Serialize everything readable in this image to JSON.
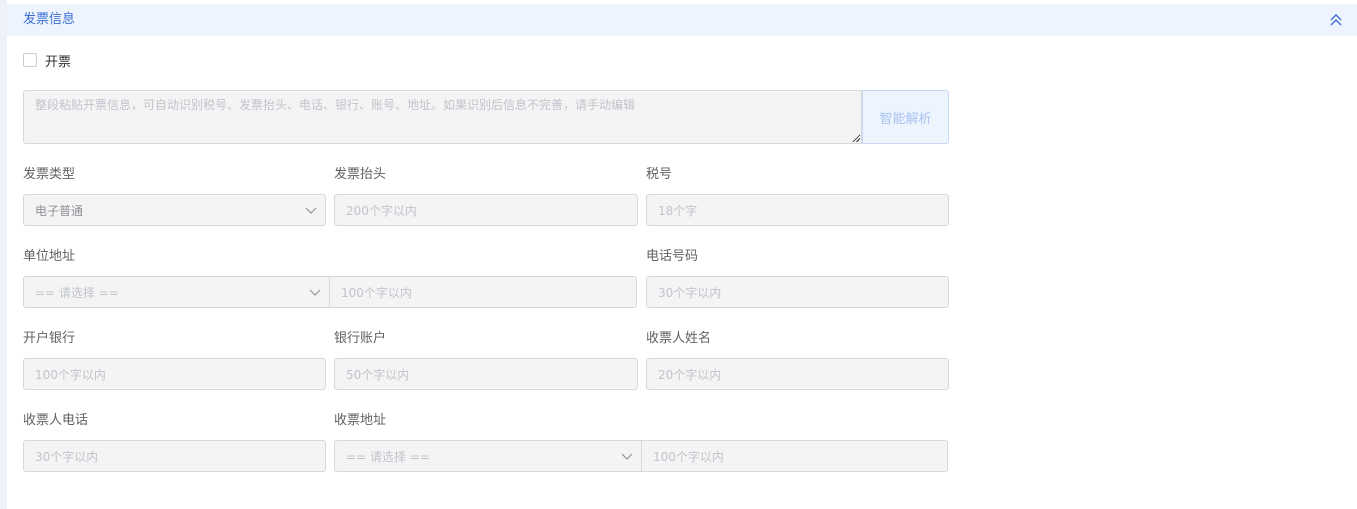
{
  "section": {
    "title": "发票信息"
  },
  "invoice_toggle": {
    "label": "开票",
    "checked": false
  },
  "paste": {
    "placeholder": "整段粘贴开票信息，可自动识别税号、发票抬头、电话、银行、账号、地址。如果识别后信息不完善，请手动编辑",
    "parse_button": "智能解析"
  },
  "fields": {
    "invoice_type": {
      "label": "发票类型",
      "value": "电子普通"
    },
    "invoice_title": {
      "label": "发票抬头",
      "placeholder": "200个字以内"
    },
    "tax_number": {
      "label": "税号",
      "placeholder": "18个字"
    },
    "company_address": {
      "label": "单位地址",
      "select_placeholder": "== 请选择 ==",
      "placeholder": "100个字以内"
    },
    "phone": {
      "label": "电话号码",
      "placeholder": "30个字以内"
    },
    "bank": {
      "label": "开户银行",
      "placeholder": "100个字以内"
    },
    "bank_account": {
      "label": "银行账户",
      "placeholder": "50个字以内"
    },
    "receiver_name": {
      "label": "收票人姓名",
      "placeholder": "20个字以内"
    },
    "receiver_phone": {
      "label": "收票人电话",
      "placeholder": "30个字以内"
    },
    "receiver_address": {
      "label": "收票地址",
      "select_placeholder": "== 请选择 ==",
      "placeholder": "100个字以内"
    }
  },
  "colors": {
    "accent": "#3d6fd6",
    "header_bg": "#eef4fe",
    "input_bg": "#f4f4f5",
    "border": "#d6d9de"
  },
  "icons": {
    "collapse": "double-chevron-up-icon",
    "dropdown": "chevron-down-icon"
  }
}
